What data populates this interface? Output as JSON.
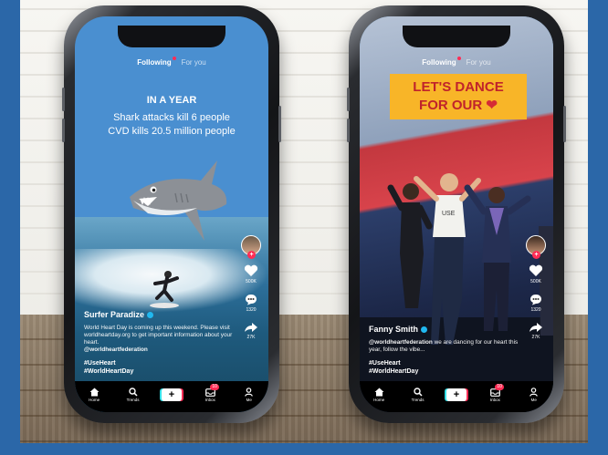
{
  "phones": [
    {
      "tabs": {
        "following": "Following",
        "for_you": "For you"
      },
      "stats": {
        "heading": "IN A YEAR",
        "line1": "Shark attacks kill 6 people",
        "line2": "CVD kills 20.5 million people"
      },
      "rail": {
        "likes": "500K",
        "comments": "1320",
        "shares": "27K"
      },
      "caption": {
        "username": "Surfer Paradize",
        "description": "World Heart Day is coming up this weekend. Please visit worldheartday.org to get important information about your heart.",
        "mention": "@worldheartfederation",
        "tag1": "#UseHeart",
        "tag2": "#WorldHeartDay"
      }
    },
    {
      "tabs": {
        "following": "Following",
        "for_you": "For you"
      },
      "banner": {
        "line1": "LET'S DANCE",
        "line2": "FOR OUR"
      },
      "rail": {
        "likes": "500K",
        "comments": "1320",
        "shares": "27K"
      },
      "caption": {
        "username": "Fanny Smith",
        "mention": "@worldheartfederation",
        "description": "we are dancing for our heart this year, follow the vibe...",
        "tag1": "#UseHeart",
        "tag2": "#WorldHeartDay"
      }
    }
  ],
  "nav": {
    "home": "Home",
    "trends": "Trends",
    "plus": "+",
    "inbox": "Inbox",
    "inbox_badge": "10",
    "me": "Me"
  },
  "colors": {
    "frame_border": "#2b67a8",
    "accent_pink": "#ff2d55",
    "banner_yellow": "#f8b528",
    "heart_red": "#c0232b"
  }
}
